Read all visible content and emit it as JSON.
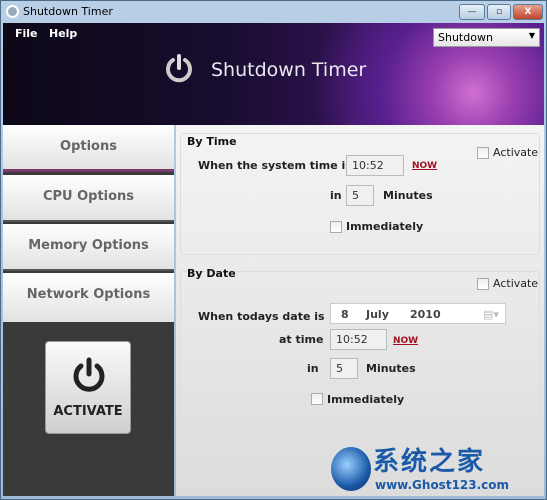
{
  "window": {
    "title": "Shutdown Timer",
    "minimize": "—",
    "maximize": "▫",
    "close": "X"
  },
  "menu": {
    "file": "File",
    "help": "Help"
  },
  "action_select": {
    "value": "Shutdown"
  },
  "header": {
    "logo_text": "Shutdown Timer"
  },
  "sidebar": {
    "tabs": [
      {
        "label": "Options"
      },
      {
        "label": "CPU Options"
      },
      {
        "label": "Memory Options"
      },
      {
        "label": "Network Options"
      }
    ],
    "activate_label": "ACTIVATE"
  },
  "by_time": {
    "title": "By Time",
    "activate": "Activate",
    "when_label": "When the system time is",
    "time": "10:52",
    "now": "NOW",
    "in_label": "in",
    "minutes": "5",
    "minutes_label": "Minutes",
    "immediately": "Immediately"
  },
  "by_date": {
    "title": "By Date",
    "activate": "Activate",
    "when_label": "When todays date is",
    "day": "8",
    "month": "July",
    "year": "2010",
    "at_time_label": "at time",
    "time": "10:52",
    "now": "NOW",
    "in_label": "in",
    "minutes": "5",
    "minutes_label": "Minutes",
    "immediately": "Immediately"
  },
  "watermark": {
    "cn": "系统之家",
    "url": "www.Ghost123.com"
  }
}
